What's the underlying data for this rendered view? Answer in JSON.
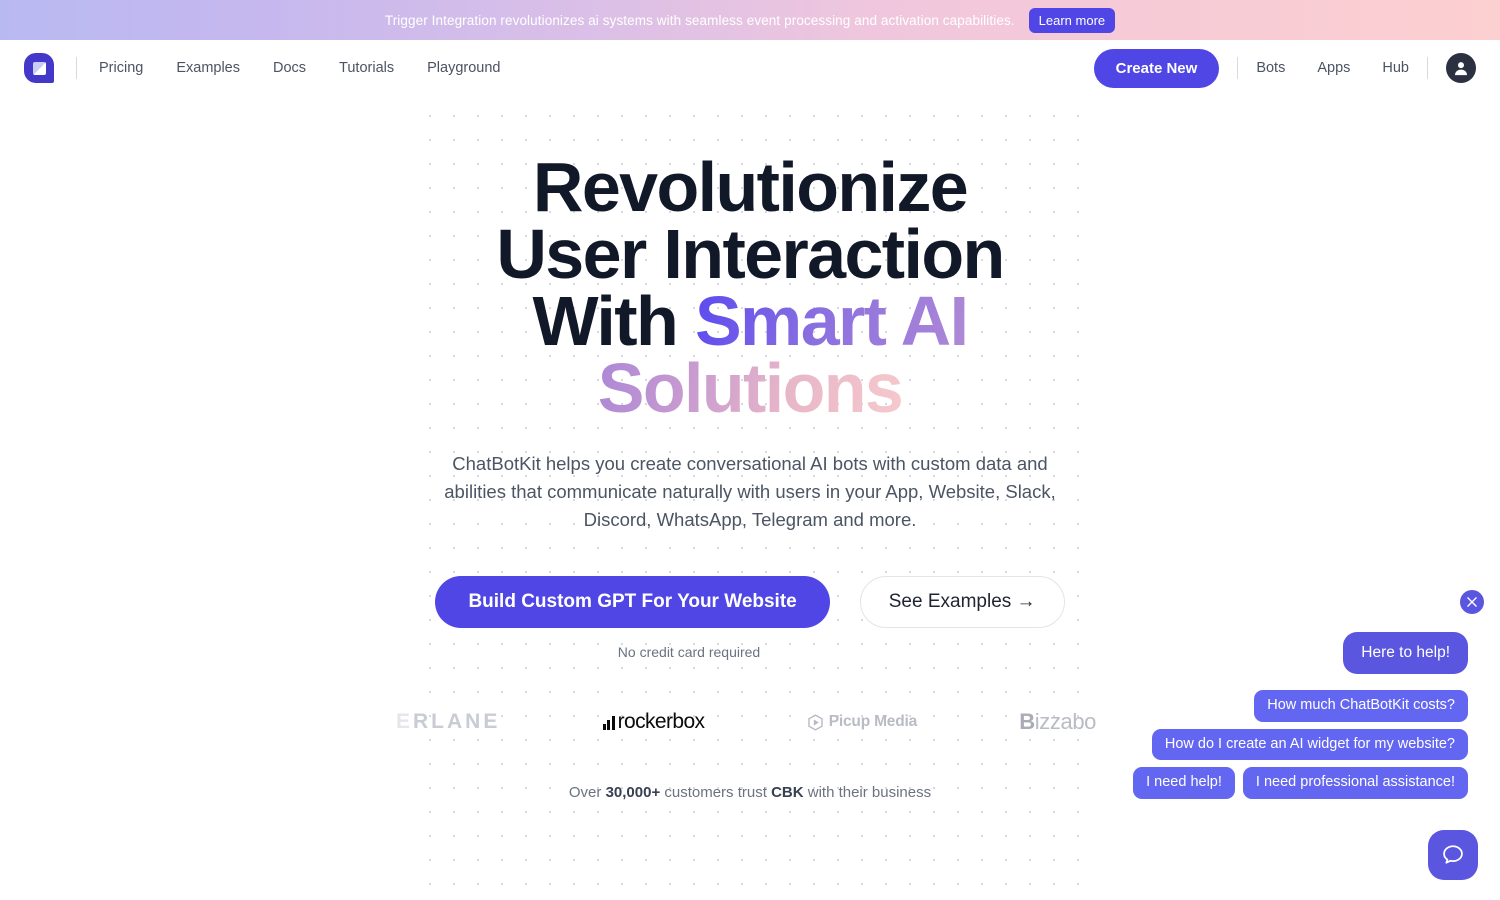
{
  "banner": {
    "message": "Trigger Integration revolutionizes ai systems with seamless event processing and activation capabilities.",
    "cta_label": "Learn more",
    "gradient_from": "#b9b9f2",
    "gradient_to": "#fccfd1",
    "cta_color": "#4f46e5"
  },
  "nav": {
    "logo_name": "chatbotkit-logo",
    "links": [
      {
        "label": "Pricing"
      },
      {
        "label": "Examples"
      },
      {
        "label": "Docs"
      },
      {
        "label": "Tutorials"
      },
      {
        "label": "Playground"
      }
    ],
    "create_label": "Create New",
    "right_links": [
      {
        "label": "Bots"
      },
      {
        "label": "Apps"
      },
      {
        "label": "Hub"
      }
    ],
    "avatar_icon": "user-avatar-icon",
    "accent": "#4f46e5"
  },
  "hero": {
    "headline_plain": "Revolutionize\nUser Interaction\nWith ",
    "headline_gradient": "Smart AI Solutions",
    "subhead": "ChatBotKit helps you create conversational AI bots with custom data and abilities that communicate naturally with users in your App, Website, Slack, Discord, WhatsApp, Telegram and more.",
    "primary_cta": "Build Custom GPT For Your Website",
    "secondary_cta": "See Examples →",
    "note": "No credit card required",
    "gradient_start": "#5b4af0",
    "gradient_end": "#f6c9cd"
  },
  "logos": {
    "erlane_dim": "E",
    "erlane": "RLANE",
    "rockerbox": "rockerbox",
    "picup": "Picup Media",
    "bizzabo_first": "B",
    "bizzabo_rest": "izzabo"
  },
  "trust": {
    "prefix": "Over ",
    "count": "30,000+",
    "middle": " customers trust ",
    "brand": "CBK",
    "suffix": " with their business"
  },
  "chat": {
    "close_icon": "close-icon",
    "launcher_icon": "chat-bubble-icon",
    "bot_message": "Here to help!",
    "suggestions_row1": [
      {
        "label": "How much ChatBotKit costs?"
      }
    ],
    "suggestions_row2": [
      {
        "label": "How do I create an AI widget for my website?"
      }
    ],
    "suggestions_row3": [
      {
        "label": "I need help!"
      },
      {
        "label": "I need professional assistance!"
      }
    ],
    "accent": "#5b56e0"
  }
}
